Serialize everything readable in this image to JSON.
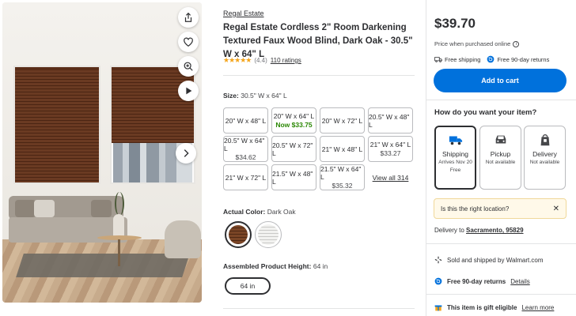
{
  "product": {
    "brand": "Regal Estate",
    "title": "Regal Estate Cordless 2\" Room Darkening Textured Faux Wood Blind, Dark Oak - 30.5\" W x 64\" L",
    "rating_stars": "★★★★★",
    "rating_value": "(4.4)",
    "rating_count": "110 ratings"
  },
  "gallery": {
    "icons": [
      "share-icon",
      "heart-icon",
      "zoom-icon",
      "play-icon",
      "chevron-right-icon"
    ]
  },
  "size": {
    "label": "Size:",
    "selected": "30.5\" W x 64\" L",
    "options": [
      {
        "name": "20\" W x 48\" L",
        "price": ""
      },
      {
        "name": "20\" W x 64\" L",
        "price": "Now $33.75",
        "now": true
      },
      {
        "name": "20\" W x 72\" L",
        "price": ""
      },
      {
        "name": "20.5\" W x 48\" L",
        "price": ""
      },
      {
        "name": "20.5\" W x 64\" L",
        "price": "$34.62"
      },
      {
        "name": "20.5\" W x 72\" L",
        "price": ""
      },
      {
        "name": "21\" W x 48\" L",
        "price": ""
      },
      {
        "name": "21\" W x 64\" L",
        "price": "$33.27"
      },
      {
        "name": "21\" W x 72\" L",
        "price": ""
      },
      {
        "name": "21.5\" W x 48\" L",
        "price": ""
      },
      {
        "name": "21.5\" W x 64\" L",
        "price": "$35.32"
      }
    ],
    "view_all": "View all 314"
  },
  "color": {
    "label": "Actual Color:",
    "selected": "Dark Oak",
    "swatches": [
      "Dark Oak",
      "White"
    ]
  },
  "height": {
    "label": "Assembled Product Height:",
    "selected": "64 in",
    "option": "64 in"
  },
  "buybox": {
    "price": "$39.70",
    "price_note": "Price when purchased online",
    "free_shipping": "Free shipping",
    "free_returns": "Free 90-day returns",
    "add_to_cart": "Add to cart",
    "how_heading": "How do you want your item?",
    "fulfillment": [
      {
        "title": "Shipping",
        "sub1": "Arrives Nov 20",
        "sub2": "Free"
      },
      {
        "title": "Pickup",
        "sub1": "Not available",
        "sub2": ""
      },
      {
        "title": "Delivery",
        "sub1": "Not available",
        "sub2": ""
      }
    ],
    "location_prompt": "Is this the right location?",
    "delivery_to": "Delivery to",
    "location": "Sacramento, 95829",
    "sold_by": "Sold and shipped by Walmart.com",
    "returns": "Free 90-day returns",
    "details": "Details",
    "gift": "This item is gift eligible",
    "learn_more": "Learn more"
  },
  "colors": {
    "accent": "#0071dc",
    "now_price": "#2a8703",
    "star": "#f4a51c"
  }
}
